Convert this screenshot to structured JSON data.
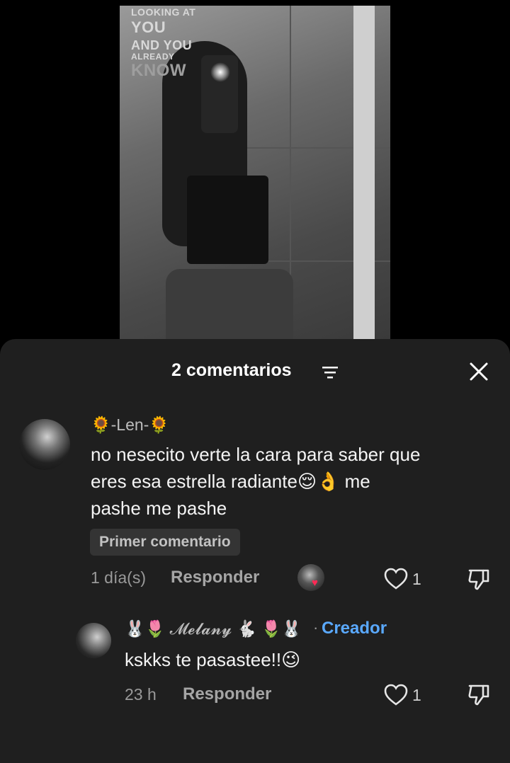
{
  "video": {
    "overlay_lines": [
      "LOOKING AT",
      "YOU",
      "AND YOU",
      "ALREADY",
      "KNOW"
    ]
  },
  "sheet": {
    "title": "2 comentarios",
    "filter_icon": "filter-lines-icon",
    "close_icon": "close-x-icon"
  },
  "comment": {
    "username": "🌻-Len-🌻",
    "text_line1": "no nesecito verte la cara para saber que",
    "text_line2": "eres esa estrella radiante😌👌  me",
    "text_line3": "pashe me pashe",
    "badge": "Primer comentario",
    "time": "1 día(s)",
    "reply_label": "Responder",
    "likes": "1"
  },
  "reply": {
    "username": "🐰🌷 𝓜𝓮𝓵𝓪𝓷𝔂 🐇 🌷🐰",
    "separator": "·",
    "creator_label": "Creador",
    "text": "kskks te pasastee!!😉",
    "time": "23 h",
    "reply_label": "Responder",
    "likes": "1"
  }
}
